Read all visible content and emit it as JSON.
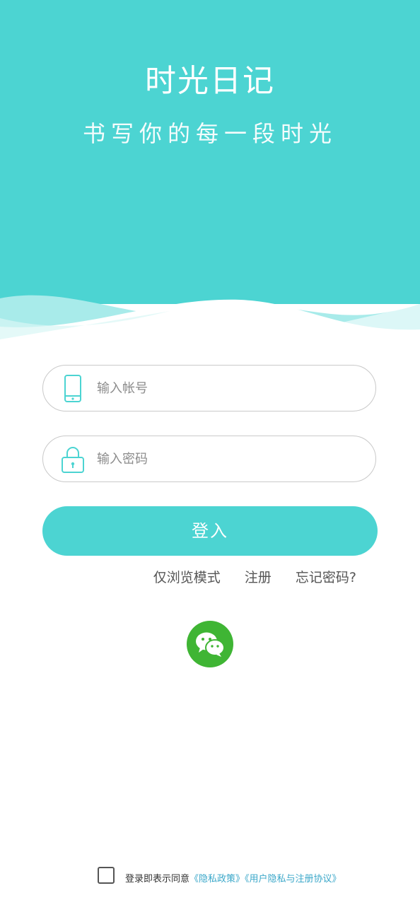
{
  "header": {
    "title": "时光日记",
    "subtitle": "书写你的每一段时光"
  },
  "form": {
    "account_placeholder": "输入帐号",
    "account_value": "",
    "password_placeholder": "输入密码",
    "password_value": "",
    "login_label": "登入"
  },
  "links": {
    "guest_mode": "仅浏览模式",
    "register": "注册",
    "forgot_password": "忘记密码?"
  },
  "social": {
    "wechat_icon": "wechat-icon"
  },
  "agreement": {
    "checked": false,
    "prefix": "登录即表示同意",
    "privacy_policy": "《隐私政策》",
    "user_agreement": "《用户隐私与注册协议》"
  },
  "colors": {
    "accent": "#4cd4d2",
    "wechat_green": "#3fb534",
    "link": "#3aa7c9"
  }
}
